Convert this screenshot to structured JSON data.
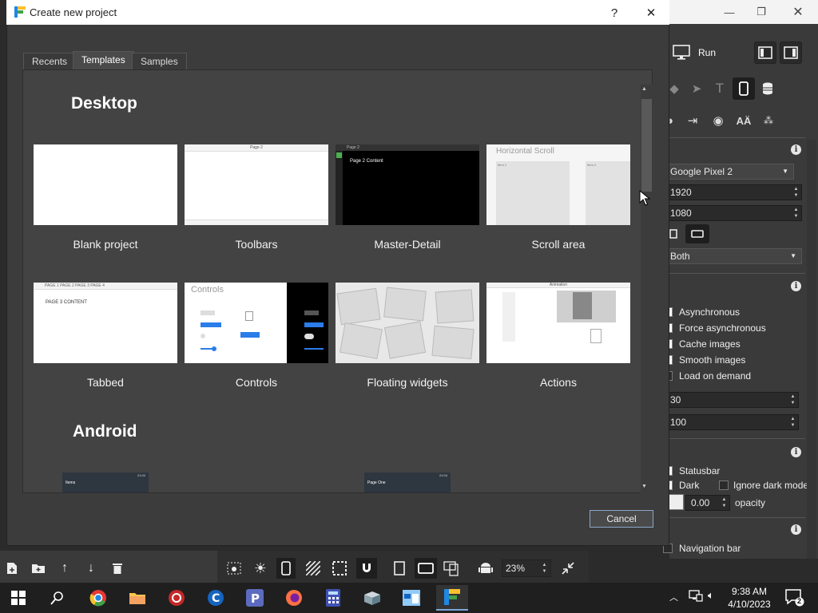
{
  "dialog": {
    "title": "Create new project",
    "help": "?",
    "close": "✕",
    "tabs": [
      {
        "label": "Recents",
        "active": false
      },
      {
        "label": "Templates",
        "active": true
      },
      {
        "label": "Samples",
        "active": false
      }
    ],
    "sections": {
      "desktop": "Desktop",
      "android": "Android"
    },
    "templates": [
      {
        "label": "Blank project"
      },
      {
        "label": "Toolbars",
        "preview_title": "Page 2"
      },
      {
        "label": "Master-Detail",
        "preview_text": "Page 2 Content",
        "preview_title": "Page 2"
      },
      {
        "label": "Scroll area",
        "preview_title": "Horizontal Scroll",
        "preview_items": [
          "Item 1",
          "Item 2"
        ]
      },
      {
        "label": "Tabbed",
        "preview_tabs": "PAGE 1   PAGE 2   PAGE 3   PAGE 4",
        "preview_text": "PAGE 3 CONTENT"
      },
      {
        "label": "Controls",
        "preview_title": "Controls"
      },
      {
        "label": "Floating widgets"
      },
      {
        "label": "Actions",
        "preview_title": "Animation"
      }
    ],
    "android_previews": [
      {
        "status": "21:04",
        "title": "Items"
      },
      {
        "status": "21:04",
        "title": "Page One"
      }
    ],
    "cancel": "Cancel"
  },
  "app": {
    "run_label": "Run",
    "device": "Google Pixel 2",
    "height": "1920",
    "width": "1080",
    "orientation": "Both",
    "options": [
      {
        "label": "Asynchronous",
        "checked": true
      },
      {
        "label": "Force asynchronous",
        "checked": true
      },
      {
        "label": "Cache images",
        "checked": true
      },
      {
        "label": "Smooth images",
        "checked": true
      },
      {
        "label": "Load on demand",
        "checked": false
      }
    ],
    "value_a": "30",
    "value_b": "100",
    "statusbar": "Statusbar",
    "dark": "Dark",
    "ignore_dark": "Ignore dark mode",
    "opacity_value": "0.00",
    "opacity_label": "opacity",
    "navbar": "Navigation bar",
    "zoom": "23%"
  },
  "taskbar": {
    "time": "9:38 AM",
    "date": "4/10/2023",
    "notifications": "2"
  },
  "colors": {
    "dialog_bg": "#3c3c3c",
    "content_bg": "#434343",
    "accent_blue": "#1a6fd6"
  }
}
